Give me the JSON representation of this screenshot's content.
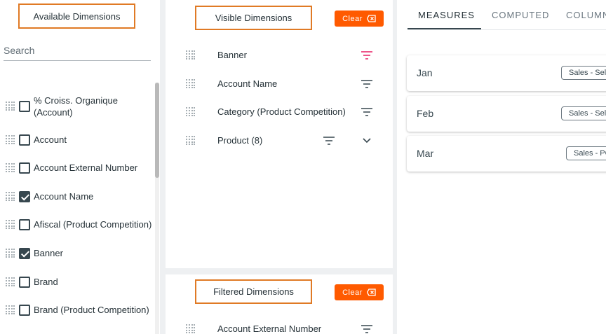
{
  "available": {
    "title": "Available Dimensions",
    "search_placeholder": "Search",
    "items": [
      {
        "label": "% Croiss. Organique",
        "label2": "(Account)",
        "checked": false
      },
      {
        "label": "Account",
        "checked": false
      },
      {
        "label": "Account External Number",
        "checked": false
      },
      {
        "label": "Account Name",
        "checked": true
      },
      {
        "label": "Afiscal (Product Competition)",
        "checked": false
      },
      {
        "label": "Banner",
        "checked": true
      },
      {
        "label": "Brand",
        "checked": false
      },
      {
        "label": "Brand (Product Competition)",
        "checked": false
      }
    ]
  },
  "visible": {
    "title": "Visible Dimensions",
    "clear_label": "Clear",
    "items": [
      {
        "label": "Banner",
        "filter_active": true
      },
      {
        "label": "Account Name",
        "filter_active": false
      },
      {
        "label": "Category (Product Competition)",
        "filter_active": false
      },
      {
        "label": "Product (8)",
        "filter_active": false,
        "expandable": true
      }
    ]
  },
  "filtered": {
    "title": "Filtered Dimensions",
    "clear_label": "Clear",
    "items": [
      {
        "label": "Account External Number"
      }
    ]
  },
  "tabs": [
    {
      "label": "MEASURES",
      "active": true
    },
    {
      "label": "COMPUTED",
      "active": false
    },
    {
      "label": "COLUMN",
      "active": false
    }
  ],
  "measures": [
    {
      "label": "Jan",
      "chip": "Sales - Sell"
    },
    {
      "label": "Feb",
      "chip": "Sales - Sell"
    },
    {
      "label": "Mar",
      "chip": "Sales - PC"
    }
  ],
  "colors": {
    "accent": "#ff5a00",
    "highlight_border": "#e07a25",
    "active_filter": "#e91e63",
    "text": "#263238"
  }
}
